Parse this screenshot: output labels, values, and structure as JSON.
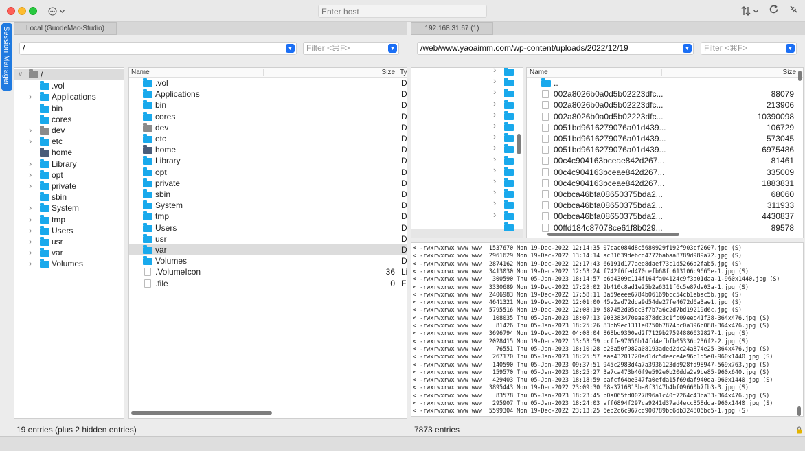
{
  "window": {
    "host_placeholder": "Enter host",
    "session_manager_label": "Session Manager",
    "menu_icon": "ellipsis-circle-icon",
    "transfer_icon": "sort-arrows-icon",
    "refresh_icon": "refresh-icon"
  },
  "local": {
    "tab_label": "Local (GuodeMac-Studio)",
    "path": "/",
    "filter_placeholder": "Filter <⌘F>",
    "tree": [
      {
        "label": "/",
        "expanded": true,
        "root": true
      },
      {
        "label": ".vol"
      },
      {
        "label": "Applications",
        "chevron": true
      },
      {
        "label": "bin"
      },
      {
        "label": "cores"
      },
      {
        "label": "dev",
        "chevron": true,
        "kind": "grey"
      },
      {
        "label": "etc",
        "chevron": true
      },
      {
        "label": "home",
        "kind": "dark"
      },
      {
        "label": "Library",
        "chevron": true
      },
      {
        "label": "opt",
        "chevron": true
      },
      {
        "label": "private",
        "chevron": true
      },
      {
        "label": "sbin"
      },
      {
        "label": "System",
        "chevron": true
      },
      {
        "label": "tmp",
        "chevron": true
      },
      {
        "label": "Users",
        "chevron": true
      },
      {
        "label": "usr",
        "chevron": true
      },
      {
        "label": "var",
        "chevron": true
      },
      {
        "label": "Volumes",
        "chevron": true
      }
    ],
    "columns": {
      "name": "Name",
      "size": "Size",
      "type": "Ty"
    },
    "files": [
      {
        "name": ".vol",
        "size": "",
        "type": "D"
      },
      {
        "name": "Applications",
        "size": "",
        "type": "D"
      },
      {
        "name": "bin",
        "size": "",
        "type": "D"
      },
      {
        "name": "cores",
        "size": "",
        "type": "D"
      },
      {
        "name": "dev",
        "size": "",
        "type": "D",
        "kind": "grey"
      },
      {
        "name": "etc",
        "size": "",
        "type": "D"
      },
      {
        "name": "home",
        "size": "",
        "type": "D",
        "kind": "dark"
      },
      {
        "name": "Library",
        "size": "",
        "type": "D"
      },
      {
        "name": "opt",
        "size": "",
        "type": "D"
      },
      {
        "name": "private",
        "size": "",
        "type": "D"
      },
      {
        "name": "sbin",
        "size": "",
        "type": "D"
      },
      {
        "name": "System",
        "size": "",
        "type": "D"
      },
      {
        "name": "tmp",
        "size": "",
        "type": "D"
      },
      {
        "name": "Users",
        "size": "",
        "type": "D"
      },
      {
        "name": "usr",
        "size": "",
        "type": "D"
      },
      {
        "name": "var",
        "size": "",
        "type": "D",
        "selected": true
      },
      {
        "name": "Volumes",
        "size": "",
        "type": "D"
      },
      {
        "name": ".VolumeIcon",
        "size": "36",
        "type": "Li",
        "kind": "file"
      },
      {
        "name": ".file",
        "size": "0",
        "type": "Fi",
        "kind": "file"
      }
    ],
    "status": "19 entries (plus 2 hidden entries)"
  },
  "remote": {
    "tab_label": "192.168.31.67 (1)",
    "path": "/web/www.yaoaimm.com/wp-content/uploads/2022/12/19",
    "filter_placeholder": "Filter <⌘F>",
    "columns": {
      "name": "Name",
      "size": "Size"
    },
    "files": [
      {
        "name": "..",
        "size": "",
        "kind": "folder"
      },
      {
        "name": "002a8026b0a0d5b02223dfc...",
        "size": "88079"
      },
      {
        "name": "002a8026b0a0d5b02223dfc...",
        "size": "213906"
      },
      {
        "name": "002a8026b0a0d5b02223dfc...",
        "size": "10390098"
      },
      {
        "name": "0051bd9616279076a01d439...",
        "size": "106729"
      },
      {
        "name": "0051bd9616279076a01d439...",
        "size": "573045"
      },
      {
        "name": "0051bd9616279076a01d439...",
        "size": "6975486"
      },
      {
        "name": "00c4c904163bceae842d267...",
        "size": "81461"
      },
      {
        "name": "00c4c904163bceae842d267...",
        "size": "335009"
      },
      {
        "name": "00c4c904163bceae842d267...",
        "size": "1883831"
      },
      {
        "name": "00cbca46bfa08650375bda2...",
        "size": "68060"
      },
      {
        "name": "00cbca46bfa08650375bda2...",
        "size": "311933"
      },
      {
        "name": "00cbca46bfa08650375bda2...",
        "size": "4430837"
      },
      {
        "name": "00ffd184c87078ce61f8b029...",
        "size": "89578"
      }
    ],
    "status": "7873 entries",
    "log": [
      "< -rwxrwxrwx www www  1537670 Mon 19-Dec-2022 12:14:35 07cac084d8c5680929f192f903cf2607.jpg (S)",
      "< -rwxrwxrwx www www  2961629 Mon 19-Dec-2022 13:14:14 ac31639debcd4772babaa8789d989a72.jpg (S)",
      "< -rwxrwxrwx www www  2874162 Mon 19-Dec-2022 12:17:43 66191d177aee8daef73c1d5266a2fab5.jpg (S)",
      "< -rwxrwxrwx www www  3413030 Mon 19-Dec-2022 12:53:24 f742f6fed470cefb68fc613106c9665e-1.jpg (S)",
      "< -rwxrwxrwx www www   300590 Thu 05-Jan-2023 18:14:57 b6d4309c114f164fa04124c9f3a01daa-1-960x1440.jpg (S)",
      "< -rwxrwxrwx www www  3330689 Mon 19-Dec-2022 17:28:02 2b410c8ad1e25b2a6311f6c5e87de03a-1.jpg (S)",
      "< -rwxrwxrwx www www  2406983 Mon 19-Dec-2022 17:58:11 3a59eeee6784b06169bcc54cb1ebac5b.jpg (S)",
      "< -rwxrwxrwx www www  4641321 Mon 19-Dec-2022 12:01:00 45a2ad72dda9d54de27fe4672d6a3ae1.jpg (S)",
      "< -rwxrwxrwx www www  5795516 Mon 19-Dec-2022 12:08:19 587452d05cc3f7b7a6c2d7bd19219d6c.jpg (S)",
      "< -rwxrwxrwx www www   108035 Thu 05-Jan-2023 18:07:13 903383470eaa878dc3c1fc09eec41f38-364x476.jpg (S)",
      "< -rwxrwxrwx www www    81426 Thu 05-Jan-2023 18:25:26 83bb9ec1311e0750b7874bc0a396b088-364x476.jpg (S)",
      "< -rwxrwxrwx www www  3696794 Mon 19-Dec-2022 04:08:04 868bd9300ad2f7129b27594886632827-1.jpg (S)",
      "< -rwxrwxrwx www www  2028415 Mon 19-Dec-2022 13:53:59 bcffe97056b14fd4efbfb05336b236f2-2.jpg (S)",
      "< -rwxrwxrwx www www    76551 Thu 05-Jan-2023 18:10:28 e28a50f982a08193aded2dc24a874e25-364x476.jpg (S)",
      "< -rwxrwxrwx www www   267170 Thu 05-Jan-2023 18:25:57 eae43201720ad1dc5deece4e96c1d5e0-960x1440.jpg (S)",
      "< -rwxrwxrwx www www   140590 Thu 05-Jan-2023 09:37:51 945c2983d4a7a3936123dd928fd98947-569x763.jpg (S)",
      "< -rwxrwxrwx www www   159570 Thu 05-Jan-2023 18:25:27 3a7ca473b46f9e592e0b20dda2a9be85-960x640.jpg (S)",
      "< -rwxrwxrwx www www   429403 Thu 05-Jan-2023 18:18:59 bafcf64be347fa0efda15f69daf940da-960x1440.jpg (S)",
      "< -rwxrwxrwx www www  3895443 Mon 19-Dec-2022 23:09:30 68a3716813ba0f3147b4bf09660b7fb3-3.jpg (S)",
      "< -rwxrwxrwx www www    83578 Thu 05-Jan-2023 18:23:45 b0a065fd0027896a1c40f7264c43ba33-364x476.jpg (S)",
      "< -rwxrwxrwx www www   295907 Thu 05-Jan-2023 18:24:03 aff6894f297ca9241d37ad4ecc858dda-960x1440.jpg (S)",
      "< -rwxrwxrwx www www  5599304 Mon 19-Dec-2022 23:13:25 6eb2c6c967cd900789bc6db324806bc5-1.jpg (S)"
    ]
  }
}
